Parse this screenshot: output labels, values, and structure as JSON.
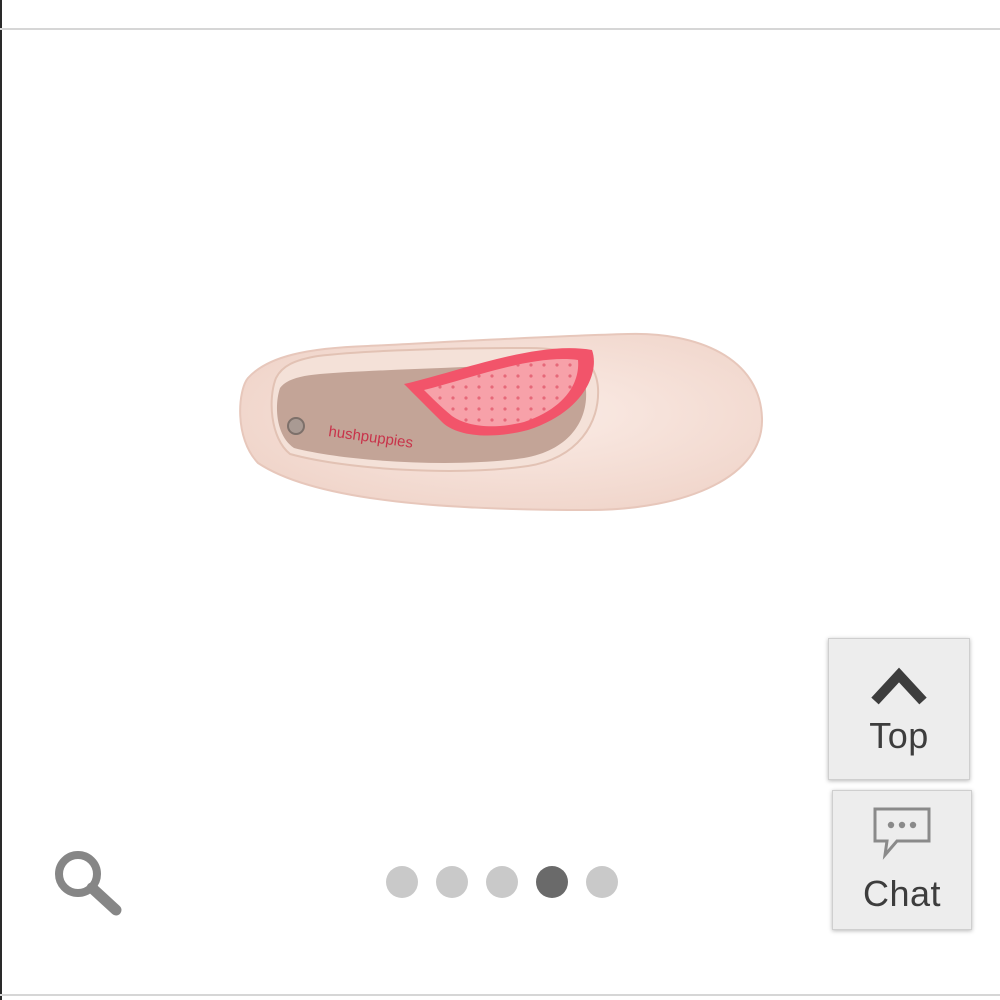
{
  "product": {
    "image_name": "pink-ballet-flat-shoe",
    "insole_brand_text": "hushpuppies",
    "shoe_color": "#f4dcd3",
    "lining_color": "#f2546a"
  },
  "zoom": {
    "icon": "magnifier-icon"
  },
  "carousel": {
    "total": 5,
    "active_index": 3,
    "active_color": "#6a6a6a",
    "inactive_color": "#c9c9c9"
  },
  "top_button": {
    "icon": "chevron-up-icon",
    "label": "Top"
  },
  "chat_button": {
    "icon": "chat-bubble-icon",
    "label": "Chat"
  }
}
